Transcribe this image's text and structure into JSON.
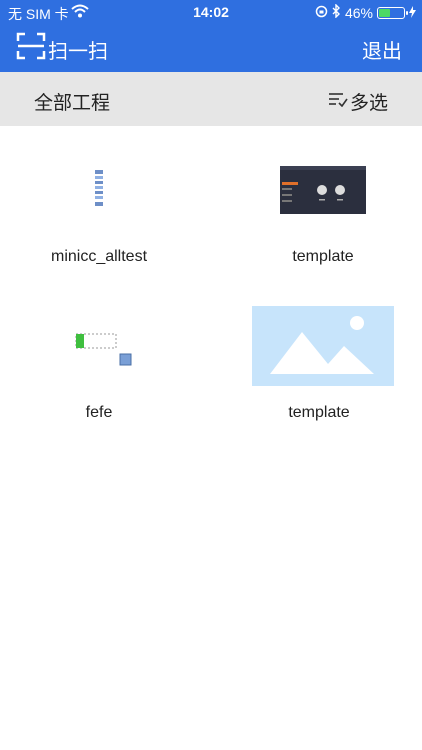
{
  "status": {
    "carrier": "无 SIM 卡",
    "time": "14:02",
    "battery": "46%",
    "battery_level": 0.46
  },
  "nav": {
    "scan_label": "扫一扫",
    "exit_label": "退出"
  },
  "toolbar": {
    "title": "全部工程",
    "multi_label": "多选"
  },
  "projects": [
    {
      "name": "minicc_alltest",
      "thumb": "vertical-list-thumbnail"
    },
    {
      "name": "template",
      "thumb": "dark-dashboard-thumbnail"
    },
    {
      "name": "fefe",
      "thumb": "progress-bar-thumbnail"
    },
    {
      "name": "template",
      "thumb": "image-placeholder-icon"
    }
  ],
  "colors": {
    "accent": "#2f6fe0",
    "toolbar_bg": "#e6e6e6",
    "placeholder_bg": "#c7e4fb"
  }
}
